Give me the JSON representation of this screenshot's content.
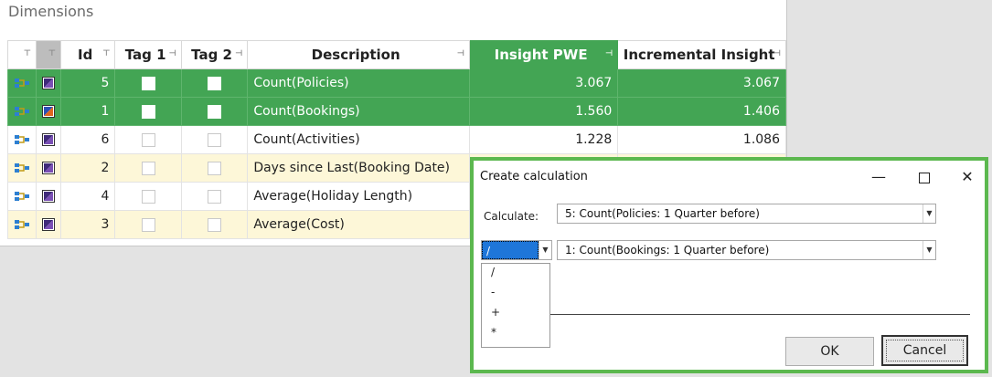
{
  "panel": {
    "title": "Dimensions"
  },
  "grid": {
    "headers": {
      "id": "Id",
      "tag1": "Tag 1",
      "tag2": "Tag 2",
      "description": "Description",
      "insight_pwe": "Insight PWE",
      "incremental": "Incremental Insight"
    },
    "rows": [
      {
        "id": "5",
        "description": "Count(Policies)",
        "pwe": "3.067",
        "incremental": "3.067"
      },
      {
        "id": "1",
        "description": "Count(Bookings)",
        "pwe": "1.560",
        "incremental": "1.406"
      },
      {
        "id": "6",
        "description": "Count(Activities)",
        "pwe": "1.228",
        "incremental": "1.086"
      },
      {
        "id": "2",
        "description": "Days since Last(Booking Date)"
      },
      {
        "id": "4",
        "description": "Average(Holiday Length)"
      },
      {
        "id": "3",
        "description": "Average(Cost)"
      }
    ]
  },
  "dialog": {
    "title": "Create calculation",
    "calculate_label": "Calculate:",
    "first_operand": "5: Count(Policies: 1 Quarter before)",
    "operator": "/",
    "second_operand": "1: Count(Bookings: 1 Quarter before)",
    "operator_options": [
      "/",
      "-",
      "+",
      "*"
    ],
    "ok_label": "OK",
    "cancel_label": "Cancel",
    "accent_color": "#5cb84f",
    "selection_color": "#43a554"
  }
}
